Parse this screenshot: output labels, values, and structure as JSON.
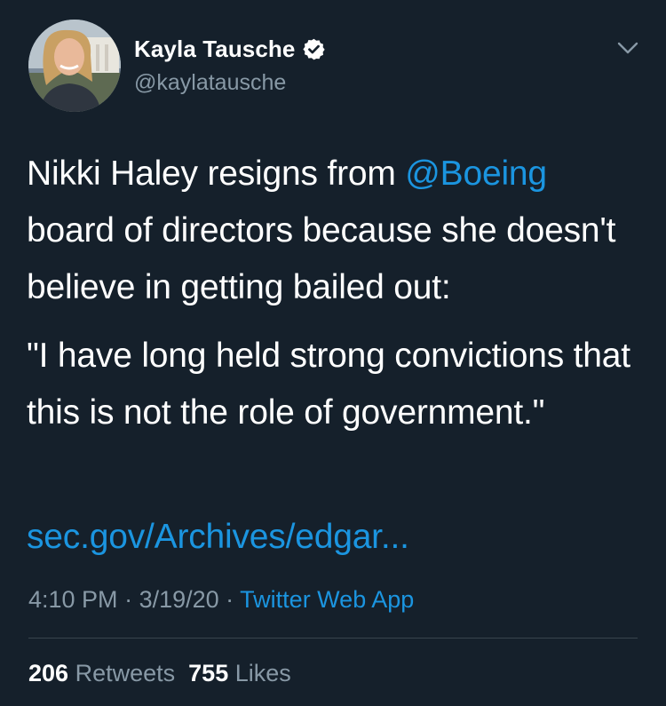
{
  "author": {
    "display_name": "Kayla Tausche",
    "handle": "@kaylatausche",
    "verified": true,
    "avatar_icon": "avatar-photo",
    "menu_icon": "chevron-down-icon"
  },
  "tweet": {
    "para1_before": "Nikki Haley resigns from ",
    "para1_mention": "@Boeing",
    "para1_after": " board of directors because she doesn't believe in getting bailed out:",
    "para2": "\"I have long held strong convictions that this is not the role of government.\"",
    "link": "sec.gov/Archives/edgar..."
  },
  "meta": {
    "time": "4:10 PM",
    "sep1": " · ",
    "date": "3/19/20",
    "sep2": " · ",
    "source": "Twitter Web App"
  },
  "stats": {
    "retweets_count": "206",
    "retweets_label": "Retweets",
    "likes_count": "755",
    "likes_label": "Likes"
  },
  "colors": {
    "background": "#15202b",
    "link": "#1b95e0",
    "secondary_text": "#8899a6",
    "primary_text": "#ffffff",
    "divider": "#38444d"
  }
}
